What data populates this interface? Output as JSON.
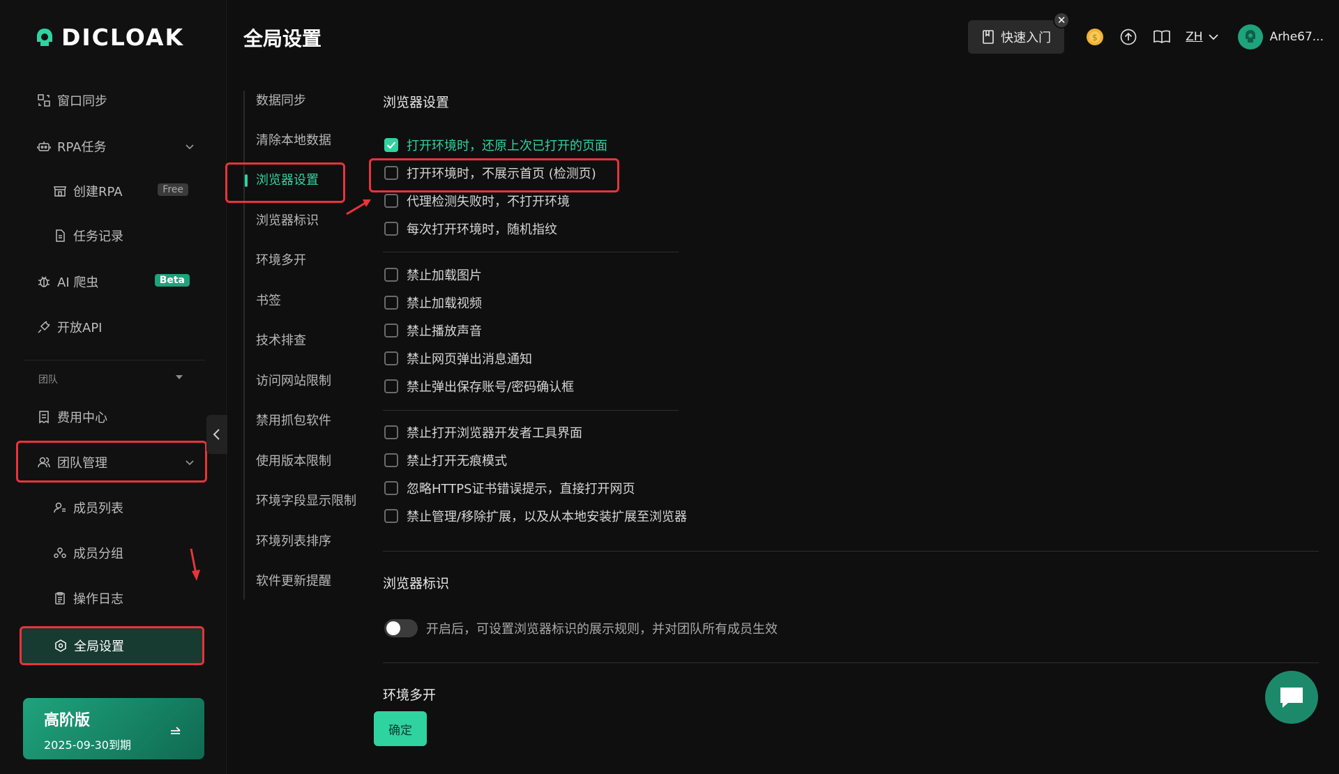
{
  "brand": {
    "name": "DICLOAK"
  },
  "page": {
    "title": "全局设置"
  },
  "topbar": {
    "quick_start": "快速入门",
    "close": "✕",
    "lang": "ZH",
    "username": "Arhe67..."
  },
  "sidebar": {
    "items": [
      {
        "label": "窗口同步"
      },
      {
        "label": "RPA任务"
      },
      {
        "label": "创建RPA",
        "tag": "Free"
      },
      {
        "label": "任务记录"
      },
      {
        "label": "AI 爬虫",
        "tag": "Beta"
      },
      {
        "label": "开放API"
      }
    ],
    "group_label": "团队",
    "team_items": [
      {
        "label": "费用中心"
      },
      {
        "label": "团队管理"
      },
      {
        "label": "成员列表"
      },
      {
        "label": "成员分组"
      },
      {
        "label": "操作日志"
      },
      {
        "label": "全局设置"
      }
    ],
    "premium": {
      "title": "高阶版",
      "expiry": "2025-09-30到期"
    }
  },
  "subnav": {
    "items": [
      "数据同步",
      "清除本地数据",
      "浏览器设置",
      "浏览器标识",
      "环境多开",
      "书签",
      "技术排查",
      "访问网站限制",
      "禁用抓包软件",
      "使用版本限制",
      "环境字段显示限制",
      "环境列表排序",
      "软件更新提醒"
    ],
    "active_index": 2
  },
  "browser_settings": {
    "title": "浏览器设置",
    "group1": [
      {
        "label": "打开环境时，还原上次已打开的页面",
        "checked": true
      },
      {
        "label": "打开环境时，不展示首页 (检测页)",
        "checked": false
      },
      {
        "label": "代理检测失败时，不打开环境",
        "checked": false
      },
      {
        "label": "每次打开环境时，随机指纹",
        "checked": false
      }
    ],
    "group2": [
      {
        "label": "禁止加载图片",
        "checked": false
      },
      {
        "label": "禁止加载视频",
        "checked": false
      },
      {
        "label": "禁止播放声音",
        "checked": false
      },
      {
        "label": "禁止网页弹出消息通知",
        "checked": false
      },
      {
        "label": "禁止弹出保存账号/密码确认框",
        "checked": false
      }
    ],
    "group3": [
      {
        "label": "禁止打开浏览器开发者工具界面",
        "checked": false
      },
      {
        "label": "禁止打开无痕模式",
        "checked": false
      },
      {
        "label": "忽略HTTPS证书错误提示，直接打开网页",
        "checked": false
      },
      {
        "label": "禁止管理/移除扩展，以及从本地安装扩展至浏览器",
        "checked": false
      }
    ]
  },
  "browser_identity": {
    "title": "浏览器标识",
    "toggle_label": "开启后，可设置浏览器标识的展示规则，并对团队所有成员生效",
    "toggle_on": false
  },
  "multi_env": {
    "title": "环境多开"
  },
  "confirm_button": "确定",
  "colors": {
    "accent": "#2fd3a0",
    "annotation": "#e8343a",
    "background": "#0f0f0f"
  }
}
